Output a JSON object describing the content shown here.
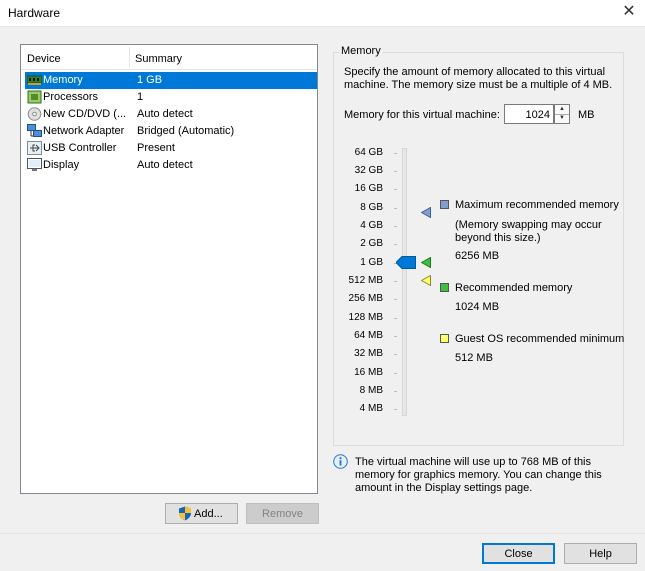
{
  "window": {
    "title": "Hardware"
  },
  "devices": {
    "header_device": "Device",
    "header_summary": "Summary",
    "rows": [
      {
        "name": "Memory",
        "summary": "1 GB",
        "icon": "memory-icon"
      },
      {
        "name": "Processors",
        "summary": "1",
        "icon": "processor-icon"
      },
      {
        "name": "New CD/DVD (...",
        "summary": "Auto detect",
        "icon": "cd-dvd-icon"
      },
      {
        "name": "Network Adapter",
        "summary": "Bridged (Automatic)",
        "icon": "network-adapter-icon"
      },
      {
        "name": "USB Controller",
        "summary": "Present",
        "icon": "usb-icon"
      },
      {
        "name": "Display",
        "summary": "Auto detect",
        "icon": "display-icon"
      }
    ],
    "selected_index": 0,
    "add_label": "Add...",
    "remove_label": "Remove"
  },
  "memory": {
    "group_label": "Memory",
    "description": "Specify the amount of memory allocated to this virtual machine. The memory size must be a multiple of 4 MB.",
    "field_label": "Memory for this virtual machine:",
    "value": "1024",
    "unit": "MB",
    "scale_labels": [
      "64 GB",
      "32 GB",
      "16 GB",
      "8 GB",
      "4 GB",
      "2 GB",
      "1 GB",
      "512 MB",
      "256 MB",
      "128 MB",
      "64 MB",
      "32 MB",
      "16 MB",
      "8 MB",
      "4 MB"
    ],
    "current_value": "1 GB",
    "max_recommended": {
      "label": "Maximum recommended memory",
      "note": "(Memory swapping may occur beyond this size.)",
      "value": "6256 MB",
      "color": "#7f9fcf"
    },
    "recommended": {
      "label": "Recommended memory",
      "value": "1024 MB",
      "color": "#3fbf3f"
    },
    "guest_min": {
      "label": "Guest OS recommended minimum",
      "value": "512 MB",
      "color": "#ffff66"
    },
    "slider_color": "#0078d7"
  },
  "info": {
    "text": "The virtual machine will use up to 768 MB of this memory for graphics memory. You can change this amount in the Display settings page."
  },
  "footer": {
    "close_label": "Close",
    "help_label": "Help"
  }
}
